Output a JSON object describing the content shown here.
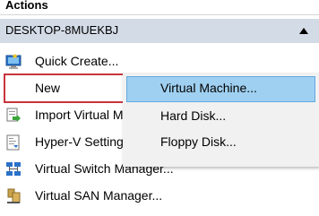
{
  "panel": {
    "title": "Actions"
  },
  "section": {
    "title": "DESKTOP-8MUEKBJ"
  },
  "items": [
    {
      "label": "Quick Create...",
      "icon": "quick-create-icon"
    },
    {
      "label": "New",
      "icon": ""
    },
    {
      "label": "Import Virtual Machine...",
      "icon": "import-vm-icon"
    },
    {
      "label": "Hyper-V Settings...",
      "icon": "settings-icon"
    },
    {
      "label": "Virtual Switch Manager...",
      "icon": "switch-manager-icon"
    },
    {
      "label": "Virtual SAN Manager...",
      "icon": "san-manager-icon"
    }
  ],
  "submenu": {
    "items": [
      {
        "label": "Virtual Machine..."
      },
      {
        "label": "Hard Disk..."
      },
      {
        "label": "Floppy Disk..."
      }
    ]
  },
  "colors": {
    "section_bg": "#d3dbe6",
    "highlight_border": "#c8343b",
    "submenu_hover": "#9fd0f1"
  }
}
